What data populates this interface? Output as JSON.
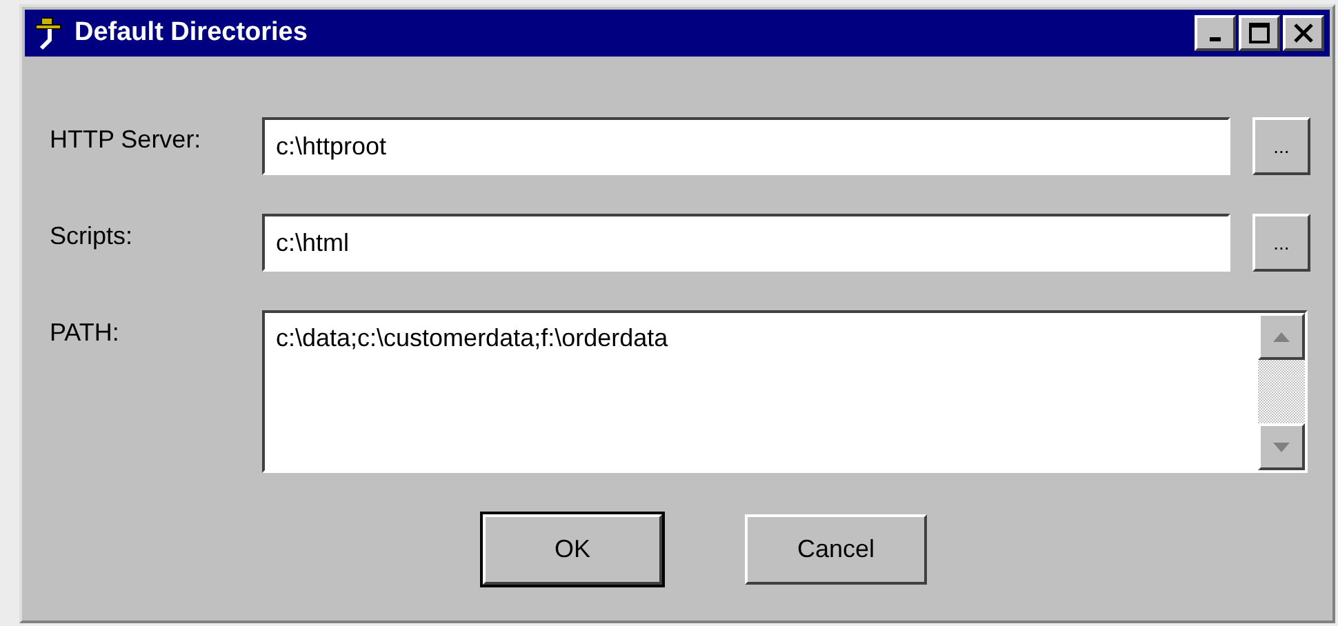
{
  "window": {
    "title": "Default Directories"
  },
  "fields": [
    {
      "kind": "line",
      "label": "HTTP Server:",
      "value": "c:\\httproot",
      "browse": "..."
    },
    {
      "kind": "line",
      "label": "Scripts:",
      "value": "c:\\html",
      "browse": "..."
    },
    {
      "kind": "area",
      "label": "PATH:",
      "value": "c:\\data;c:\\customerdata;f:\\orderdata"
    }
  ],
  "buttons": [
    {
      "label": "OK",
      "default": true
    },
    {
      "label": "Cancel",
      "default": false
    }
  ]
}
